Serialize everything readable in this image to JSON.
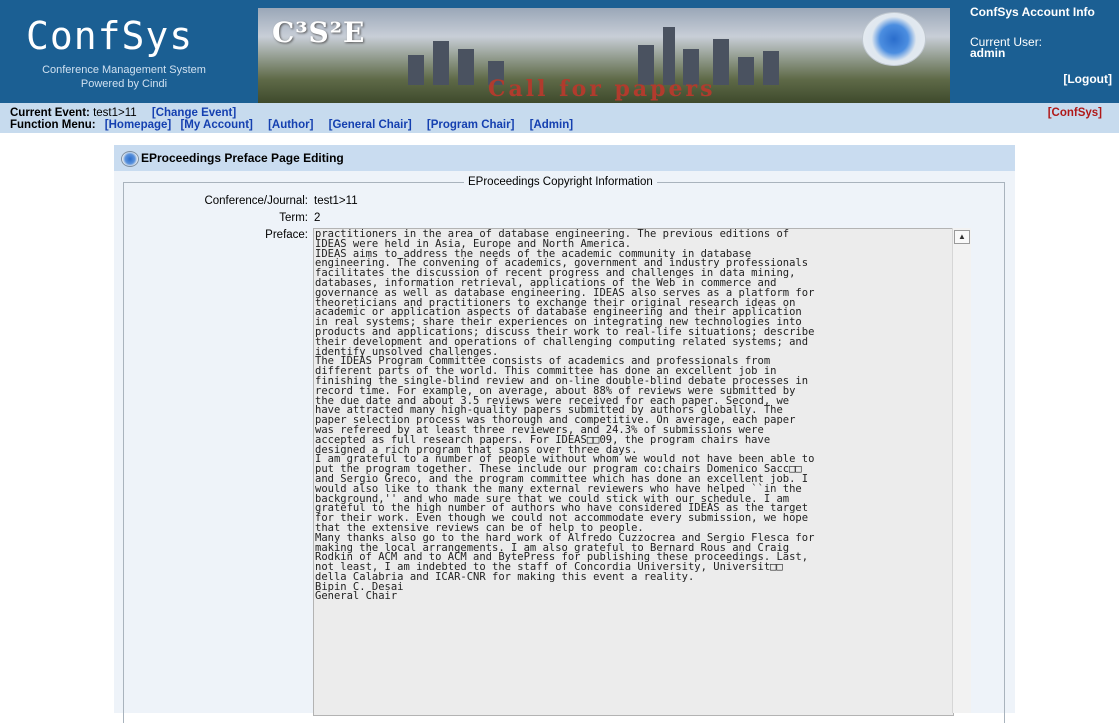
{
  "header": {
    "app_title": "ConfSys",
    "subtitle": "Conference Management System",
    "powered": "Powered by Cindi",
    "banner_logo_text": "C³S²E",
    "banner_tagline": "Call for papers"
  },
  "account": {
    "title": "ConfSys Account Info",
    "current_user_label": "Current User:",
    "username": "admin",
    "logout": "[Logout]"
  },
  "menu": {
    "current_event_label": "Current Event:",
    "current_event_value": "test1>11",
    "change_event": "[Change Event]",
    "function_menu_label": "Function Menu:",
    "items": [
      "[Homepage]",
      "[My Account]",
      "[Author]",
      "[General Chair]",
      "[Program Chair]",
      "[Admin]"
    ],
    "confsys_link": "[ConfSys]"
  },
  "panel": {
    "title": "EProceedings Preface Page Editing",
    "legend": "EProceedings Copyright Information",
    "conference_label": "Conference/Journal:",
    "conference_value": "test1>11",
    "term_label": "Term:",
    "term_value": "2",
    "preface_label": "Preface:",
    "preface_text": "practitioners in the area of database engineering. The previous editions of\nIDEAS were held in Asia, Europe and North America.\nIDEAS aims to address the needs of the academic community in database\nengineering. The convening of academics, government and industry professionals\nfacilitates the discussion of recent progress and challenges in data mining,\ndatabases, information retrieval, applications of the Web in commerce and\ngovernance as well as database engineering. IDEAS also serves as a platform for\ntheoreticians and practitioners to exchange their original research ideas on\nacademic or application aspects of database engineering and their application\nin real systems; share their experiences on integrating new technologies into\nproducts and applications; discuss their work to real-life situations; describe\ntheir development and operations of challenging computing related systems; and\nidentify unsolved challenges.\nThe IDEAS Program Committee consists of academics and professionals from\ndifferent parts of the world. This committee has done an excellent job in\nfinishing the single-blind review and on-line double-blind debate processes in\nrecord time. For example, on average, about 88% of reviews were submitted by\nthe due date and about 3.5 reviews were received for each paper. Second, we\nhave attracted many high-quality papers submitted by authors globally. The\npaper selection process was thorough and competitive. On average, each paper\nwas refereed by at least three reviewers, and 24.3% of submissions were\naccepted as full research papers. For IDEAS□□09, the program chairs have\ndesigned a rich program that spans over three days.\nI am grateful to a number of people without whom we would not have been able to\nput the program together. These include our program co:chairs Domenico Sacc□□\nand Sergio Greco, and the program committee which has done an excellent job. I\nwould also like to thank the many external reviewers who have helped ``in the\nbackground,'' and who made sure that we could stick with our schedule. I am\ngrateful to the high number of authors who have considered IDEAS as the target\nfor their work. Even though we could not accommodate every submission, we hope\nthat the extensive reviews can be of help to people.\nMany thanks also go to the hard work of Alfredo Cuzzocrea and Sergio Flesca for\nmaking the local arrangements. I am also grateful to Bernard Rous and Craig\nRodkin of ACM and to ACM and BytePress for publishing these proceedings. Last,\nnot least, I am indebted to the staff of Concordia University, Universit□□\ndella Calabria and ICAR-CNR for making this event a reality.\nBipin C. Desai\nGeneral Chair"
  },
  "colors": {
    "header_bg": "#1b5f93",
    "menu_bg": "#c7dbee",
    "link": "#1540b0",
    "confsys_link": "#b01818",
    "panel_bg": "#eef3f9"
  },
  "icons": [
    "seal-icon",
    "scroll-up-arrow-icon"
  ]
}
